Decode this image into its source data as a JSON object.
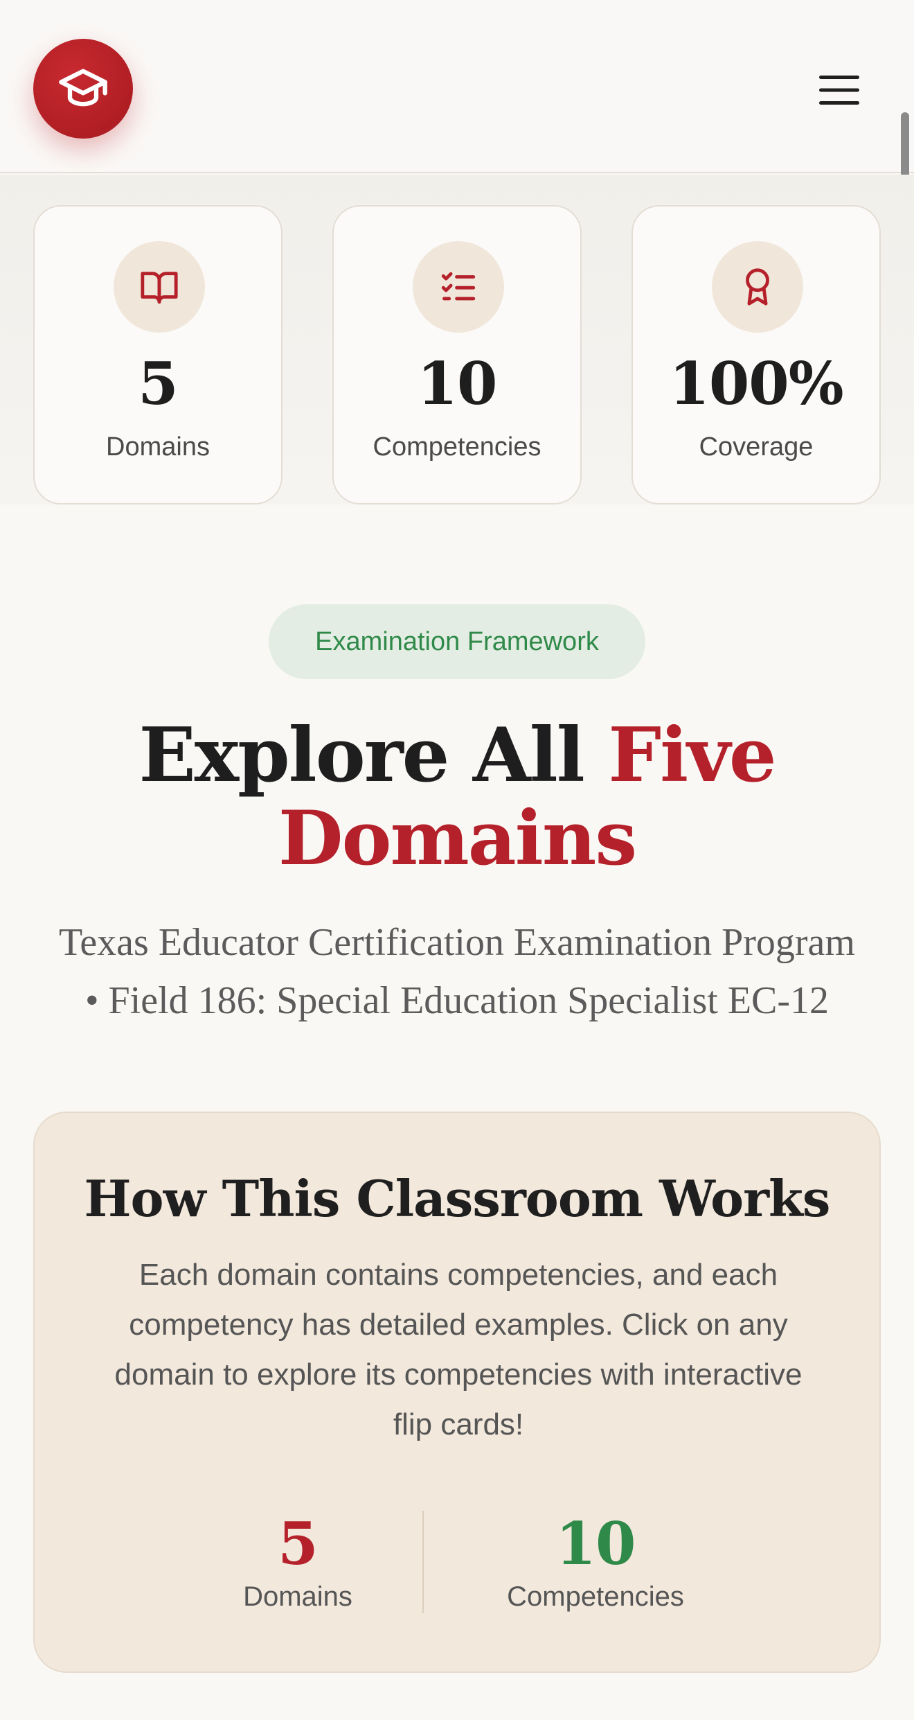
{
  "header": {
    "logo_icon": "graduation-cap-icon",
    "menu_icon": "hamburger-menu-icon"
  },
  "stats": [
    {
      "icon": "book-open-icon",
      "value": "5",
      "label": "Domains"
    },
    {
      "icon": "list-check-icon",
      "value": "10",
      "label": "Competencies"
    },
    {
      "icon": "award-ribbon-icon",
      "value": "100%",
      "label": "Coverage"
    }
  ],
  "section": {
    "badge": "Examination Framework",
    "title_part1": "Explore All ",
    "title_accent_1": "Five",
    "title_accent_2": "Domains",
    "subtitle_line1": "Texas Educator Certification Examination Program",
    "subtitle_line2": "• Field 186: Special Education Specialist EC-12"
  },
  "how_it_works": {
    "title": "How This Classroom Works",
    "text": "Each domain contains competencies, and each competency has detailed examples. Click on any domain to explore its competencies with interactive flip cards!",
    "stats": [
      {
        "value": "5",
        "label": "Domains"
      },
      {
        "value": "10",
        "label": "Competencies"
      }
    ]
  },
  "colors": {
    "brand_red": "#b5212a",
    "brand_green": "#2f8a4a",
    "icon_bg": "#f1e6da",
    "card_bg": "#f2e8dc"
  }
}
